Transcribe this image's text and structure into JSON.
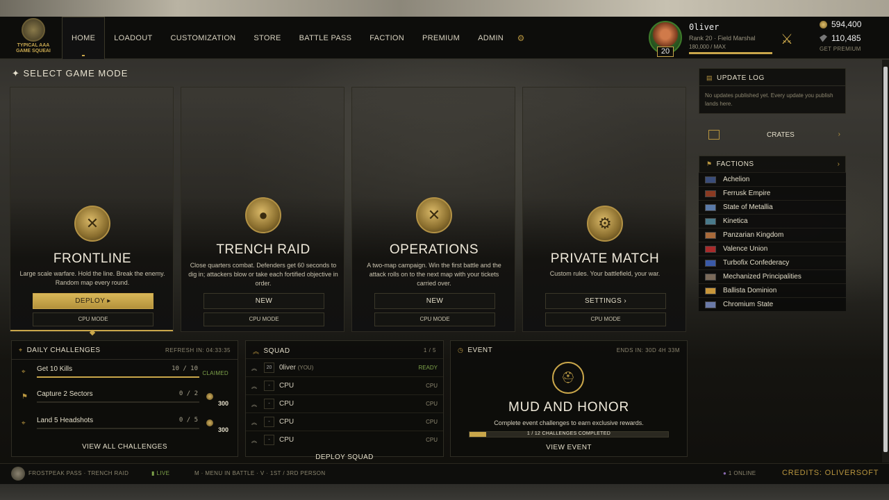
{
  "brand": {
    "logo_text_line1": "TYPICAL AAA",
    "logo_text_line2": "GAME SQUEAI",
    "logo_emblem_text": "SQUEAK"
  },
  "nav": {
    "items": [
      {
        "label": "HOME",
        "active": true
      },
      {
        "label": "LOADOUT"
      },
      {
        "label": "CUSTOMIZATION"
      },
      {
        "label": "STORE"
      },
      {
        "label": "BATTLE PASS"
      },
      {
        "label": "FACTION"
      },
      {
        "label": "PREMIUM"
      },
      {
        "label": "ADMIN"
      }
    ],
    "settings_icon": "gear-icon"
  },
  "profile": {
    "name": "0liver",
    "rank": "Rank 20 · Field Marshal",
    "xp": "180,000 / MAX",
    "level": "20",
    "xp_fraction": 1.0
  },
  "currency": {
    "coins": "594,400",
    "premium": "110,485",
    "get_premium": "GET PREMIUM"
  },
  "section_title": "SELECT GAME MODE",
  "modes": [
    {
      "title": "FRONTLINE",
      "desc": "Large scale warfare. Hold the line. Break the enemy. Random map every round.",
      "button": "DEPLOY ▸",
      "sub": "CPU MODE",
      "icon": "crossed-rifles-icon"
    },
    {
      "title": "TRENCH RAID",
      "desc": "Close quarters combat. Defenders get 60 seconds to dig in; attackers blow or take each fortified objective in order.",
      "button": "NEW",
      "sub": "CPU MODE",
      "icon": "grenade-icon"
    },
    {
      "title": "OPERATIONS",
      "desc": "A two-map campaign. Win the first battle and the attack rolls on to the next map with your tickets carried over.",
      "button": "NEW",
      "sub": "CPU MODE",
      "icon": "helmet-swords-icon"
    },
    {
      "title": "PRIVATE MATCH",
      "desc": "Custom rules. Your battlefield, your war.",
      "button": "SETTINGS ›",
      "sub": "CPU MODE",
      "icon": "lock-gear-icon"
    }
  ],
  "challenges": {
    "title": "DAILY CHALLENGES",
    "refresh": "REFRESH IN: 04:33:35",
    "items": [
      {
        "name": "Get 10 Kills",
        "progress": "10 / 10",
        "fraction": 1.0,
        "status": "CLAIMED"
      },
      {
        "name": "Capture 2 Sectors",
        "progress": "0 / 2",
        "fraction": 0,
        "reward": "300"
      },
      {
        "name": "Land 5 Headshots",
        "progress": "0 / 5",
        "fraction": 0,
        "reward": "300"
      }
    ],
    "view_all": "VIEW ALL CHALLENGES"
  },
  "squad": {
    "title": "SQUAD",
    "count": "1 / 5",
    "members": [
      {
        "rank": "20",
        "name": "0liver",
        "tag": "(YOU)",
        "status": "READY"
      },
      {
        "rank": "-",
        "name": "CPU",
        "status": "CPU"
      },
      {
        "rank": "-",
        "name": "CPU",
        "status": "CPU"
      },
      {
        "rank": "-",
        "name": "CPU",
        "status": "CPU"
      },
      {
        "rank": "-",
        "name": "CPU",
        "status": "CPU"
      }
    ],
    "deploy": "DEPLOY SQUAD"
  },
  "event": {
    "title_label": "EVENT",
    "ends": "ENDS IN: 30D 4H 33M",
    "name": "MUD AND HONOR",
    "desc": "Complete event challenges to earn exclusive rewards.",
    "progress_label": "1 / 12 CHALLENGES COMPLETED",
    "fraction": 0.083,
    "view": "VIEW EVENT"
  },
  "update_log": {
    "title": "UPDATE LOG",
    "text": "No updates published yet. Every update you publish lands here."
  },
  "crates": {
    "label": "CRATES"
  },
  "factions": {
    "title": "FACTIONS",
    "items": [
      {
        "name": "Achelion",
        "color": "#3a4d7a"
      },
      {
        "name": "Ferrusk Empire",
        "color": "#8a3a22"
      },
      {
        "name": "State of Metallia",
        "color": "#5a7aa8"
      },
      {
        "name": "Kinetica",
        "color": "#4a7a8a"
      },
      {
        "name": "Panzarian Kingdom",
        "color": "#a86a3a"
      },
      {
        "name": "Valence Union",
        "color": "#a82a2a"
      },
      {
        "name": "Turbofix Confederacy",
        "color": "#3a5aa8"
      },
      {
        "name": "Mechanized Principalities",
        "color": "#7a6a5a"
      },
      {
        "name": "Ballista Dominion",
        "color": "#c8963a"
      },
      {
        "name": "Chromium State",
        "color": "#6a7aa8"
      }
    ]
  },
  "status": {
    "map": "FROSTPEAK PASS · TRENCH RAID",
    "live": "LIVE",
    "hint": "M · MENU IN BATTLE · V · 1ST / 3RD PERSON",
    "online": "1 ONLINE",
    "credits": "CREDITS: OLIVERSOFT"
  },
  "colors": {
    "accent": "#c9a64a",
    "ready": "#7ea34a"
  }
}
